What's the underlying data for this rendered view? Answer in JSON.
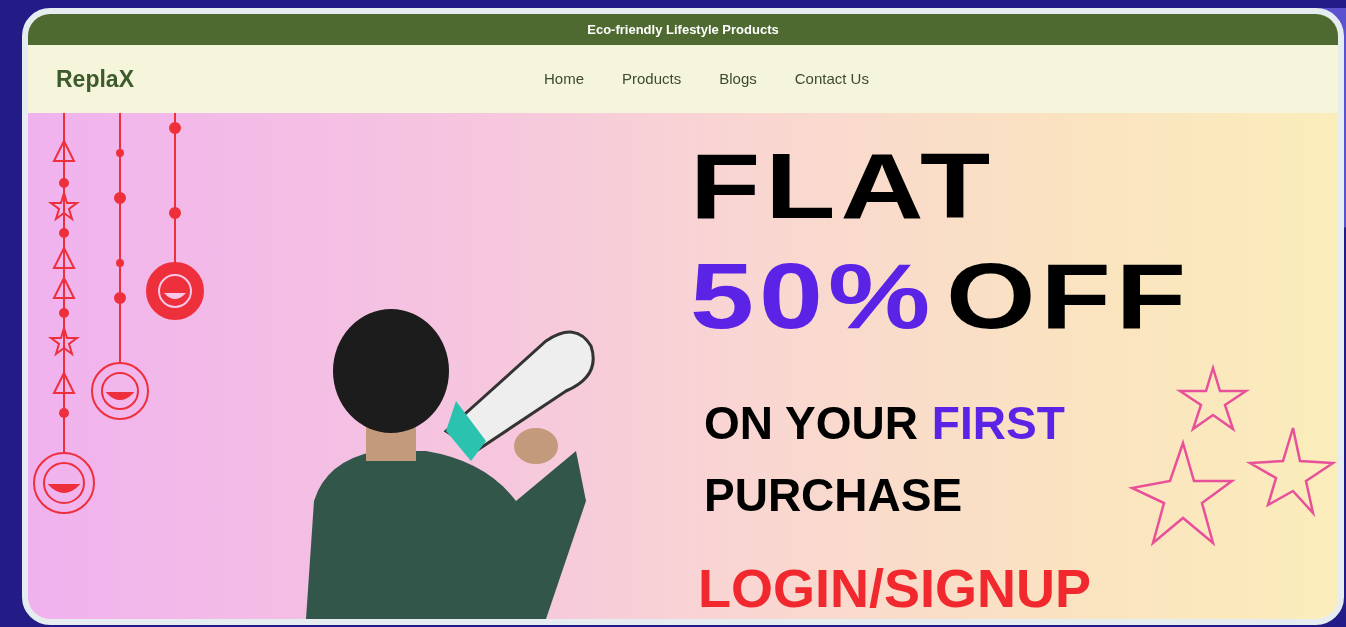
{
  "announcement_bar": {
    "text": "Eco-friendly Lifestyle Products"
  },
  "navbar": {
    "logo": "ReplaX",
    "links": [
      {
        "label": "Home"
      },
      {
        "label": "Products"
      },
      {
        "label": "Blogs"
      },
      {
        "label": "Contact Us"
      }
    ]
  },
  "hero": {
    "headline": [
      {
        "parts": [
          {
            "text": "FLAT",
            "accent": false
          }
        ]
      },
      {
        "parts": [
          {
            "text": "50%",
            "accent": true
          },
          {
            "text": "OFF",
            "accent": false
          }
        ]
      }
    ],
    "subheadline": [
      {
        "parts": [
          {
            "text": "ON YOUR",
            "accent": false
          },
          {
            "text": "FIRST",
            "accent": true
          }
        ]
      },
      {
        "parts": [
          {
            "text": "PURCHASE",
            "accent": false
          }
        ]
      }
    ],
    "cta": "LOGIN/SIGNUP"
  }
}
